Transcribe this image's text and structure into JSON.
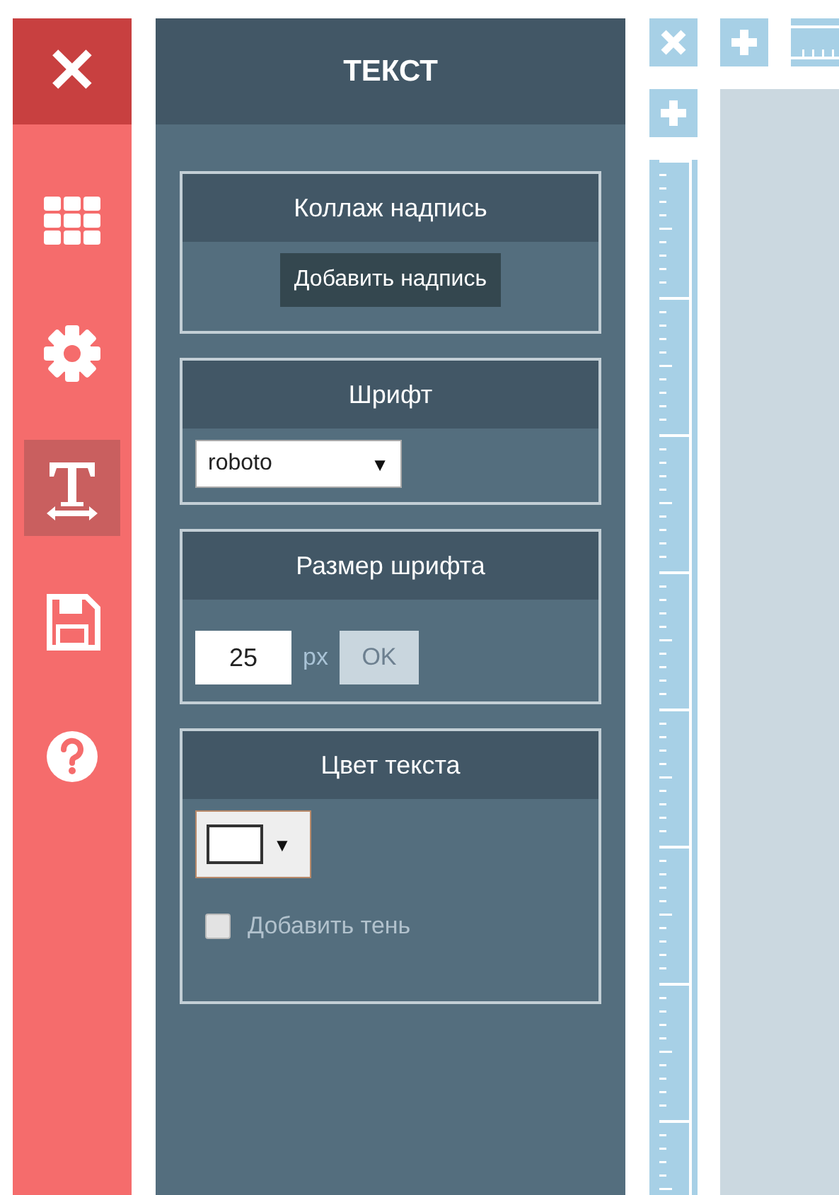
{
  "sidebar": {
    "close": "✕",
    "items": [
      {
        "kind": "grid",
        "selected": false
      },
      {
        "kind": "gear",
        "selected": false
      },
      {
        "kind": "text",
        "selected": true
      },
      {
        "kind": "save",
        "selected": false
      },
      {
        "kind": "help",
        "selected": false
      }
    ]
  },
  "panel": {
    "title": "ТЕКСТ",
    "sections": [
      {
        "kind": "button",
        "title": "Коллаж надпись",
        "button": "Добавить надпись"
      },
      {
        "kind": "select",
        "title": "Шрифт",
        "value": "roboto",
        "arrow": "▼"
      },
      {
        "kind": "size",
        "title": "Размер шрифта",
        "value": "25",
        "unit": "px",
        "button": "OK"
      },
      {
        "kind": "color",
        "title": "Цвет текста",
        "color": "#ffffff",
        "arrow": "▼",
        "checkbox": {
          "label": "Добавить тень",
          "checked": false
        }
      }
    ]
  }
}
